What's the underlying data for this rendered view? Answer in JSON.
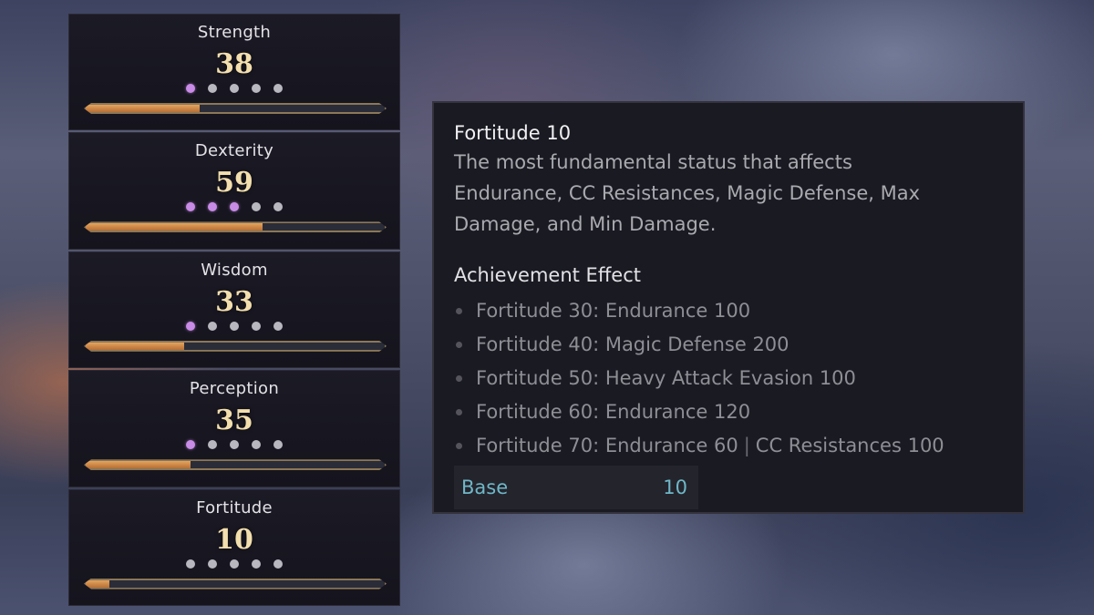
{
  "stats": [
    {
      "name": "Strength",
      "value": "38",
      "dots_filled": 1,
      "dots_total": 5,
      "bar_fraction": 0.38
    },
    {
      "name": "Dexterity",
      "value": "59",
      "dots_filled": 3,
      "dots_total": 5,
      "bar_fraction": 0.59
    },
    {
      "name": "Wisdom",
      "value": "33",
      "dots_filled": 1,
      "dots_total": 5,
      "bar_fraction": 0.33
    },
    {
      "name": "Perception",
      "value": "35",
      "dots_filled": 1,
      "dots_total": 5,
      "bar_fraction": 0.35
    },
    {
      "name": "Fortitude",
      "value": "10",
      "dots_filled": 0,
      "dots_total": 5,
      "bar_fraction": 0.08
    }
  ],
  "tooltip": {
    "title": "Fortitude 10",
    "description": "The most fundamental status that affects Endurance, CC Resistances, Magic Defense, Max Damage, and Min Damage.",
    "achievement_heading": "Achievement Effect",
    "achievements": [
      {
        "text": "Fortitude 30:  Endurance 100"
      },
      {
        "text": "Fortitude 40:  Magic Defense 200"
      },
      {
        "text": "Fortitude 50:  Heavy Attack Evasion 100"
      },
      {
        "text": "Fortitude 60:  Endurance 120"
      },
      {
        "text": "Fortitude 70:  Endurance 60",
        "extra": "CC Resistances 100"
      }
    ],
    "base_label": "Base",
    "base_value": "10"
  },
  "colors": {
    "value_gold": "#f3dfae",
    "dot_active": "#c88be6",
    "dot_inactive": "#b8b7bf",
    "bar_fill": "#d08a48",
    "base_text": "#6fb7c7"
  }
}
